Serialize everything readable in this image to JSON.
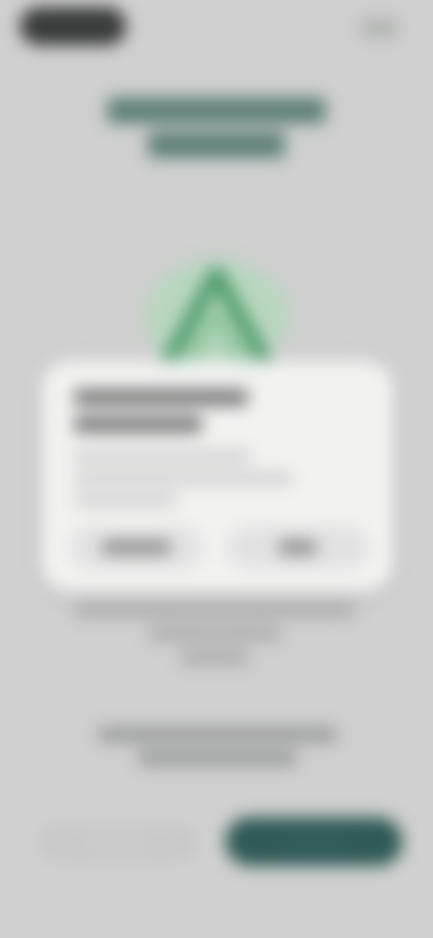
{
  "header": {
    "brand_label": "Logo",
    "skip_label": "Skip"
  },
  "headline": {
    "line1": "Your health data stays",
    "line2": "yours, always"
  },
  "dialog": {
    "title_line1": "Allow the app to access",
    "title_line2": "your health data?",
    "body_line1": "We use this data to personalise",
    "body_line2": "your experience and recommendations",
    "body_line3": "for your wellbeing.",
    "deny_label": "Don't Allow",
    "allow_label": "Allow"
  },
  "description": {
    "line1": "You can change these permissions at any time",
    "line2": "in your phone settings",
    "line3": "Learn more"
  },
  "consent": {
    "line1": "By continuing you agree to our Terms of",
    "line2": "Service and Privacy Policy"
  },
  "footer": {
    "secondary_label": "Not now",
    "primary_label": "Continue"
  },
  "colors": {
    "background": "#cfd0cf",
    "accent": "#2f5a56",
    "illustration": "#4a9a6a"
  }
}
